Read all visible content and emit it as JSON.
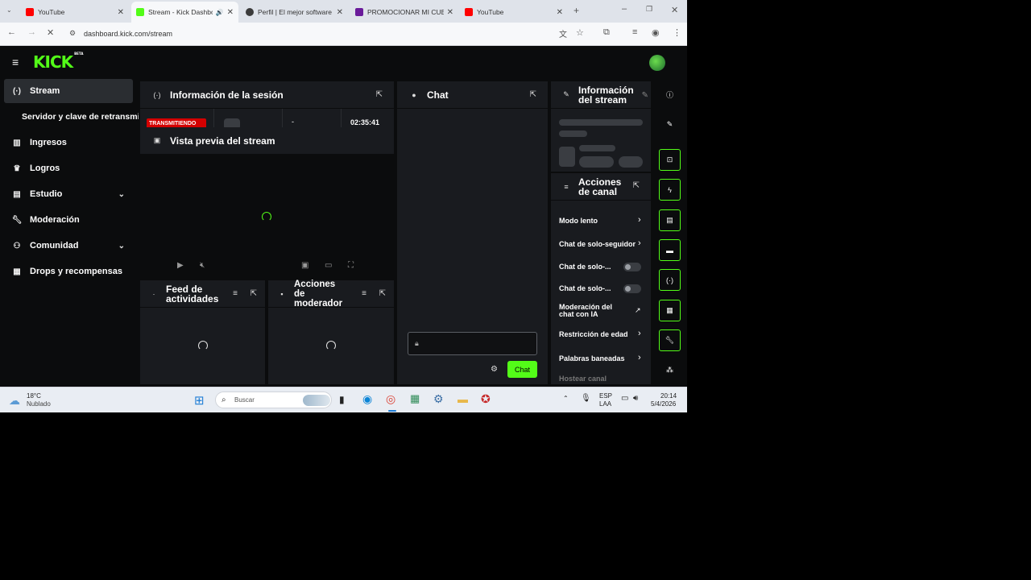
{
  "browser": {
    "tabs": [
      {
        "title": "YouTube",
        "color": "#ff0000"
      },
      {
        "title": "Stream - Kick Dashbo",
        "color": "#53fc18"
      },
      {
        "title": "Perfil | El mejor software",
        "color": "#3b3b3b"
      },
      {
        "title": "PROMOCIONAR MI CUE",
        "color": "#6a1b9a"
      },
      {
        "title": "YouTube",
        "color": "#ff0000"
      }
    ],
    "url": "dashboard.kick.com/stream"
  },
  "kick": {
    "logo": "KICK",
    "logo_badge": "BETA",
    "brand_color": "#53fc18"
  },
  "sidebar": {
    "items": [
      {
        "label": "Stream",
        "icon": "broadcast-icon"
      },
      {
        "label": "Servidor y clave de retransmisión"
      },
      {
        "label": "Ingresos",
        "icon": "chart-icon"
      },
      {
        "label": "Logros",
        "icon": "trophy-icon"
      },
      {
        "label": "Estudio",
        "icon": "studio-icon"
      },
      {
        "label": "Moderación",
        "icon": "wrench-icon"
      },
      {
        "label": "Comunidad",
        "icon": "community-icon"
      },
      {
        "label": "Drops y recompensas",
        "icon": "drops-icon"
      }
    ]
  },
  "session": {
    "title": "Información de la sesión",
    "status": "TRANSMITIENDO",
    "dash": "-",
    "time": "02:35:41"
  },
  "preview": {
    "title": "Vista previa del stream"
  },
  "feed": {
    "title_line1": "Feed de",
    "title_line2": "actividades"
  },
  "modactions": {
    "title_line1": "Acciones",
    "title_line2": "de",
    "title_line3": "moderador"
  },
  "chat": {
    "title": "Chat",
    "send_label": "Chat"
  },
  "stream_info": {
    "title_line1": "Información",
    "title_line2": "del stream"
  },
  "channel_actions": {
    "title_line1": "Acciones",
    "title_line2": "de canal",
    "rows": [
      {
        "label": "Modo lento"
      },
      {
        "label": "Chat de solo-seguidores"
      },
      {
        "label": "Chat de solo-..."
      },
      {
        "label": "Chat de solo-..."
      },
      {
        "label_line1": "Moderación del",
        "label_line2": "chat con IA"
      },
      {
        "label": "Restricción de edad"
      },
      {
        "label": "Palabras baneadas"
      },
      {
        "label": "Hostear canal"
      }
    ]
  },
  "taskbar": {
    "temp": "18°C",
    "weather": "Nublado",
    "search": "Buscar",
    "lang1": "ESP",
    "lang2": "LAA",
    "time": "20:14",
    "date": "5/4/2026"
  }
}
